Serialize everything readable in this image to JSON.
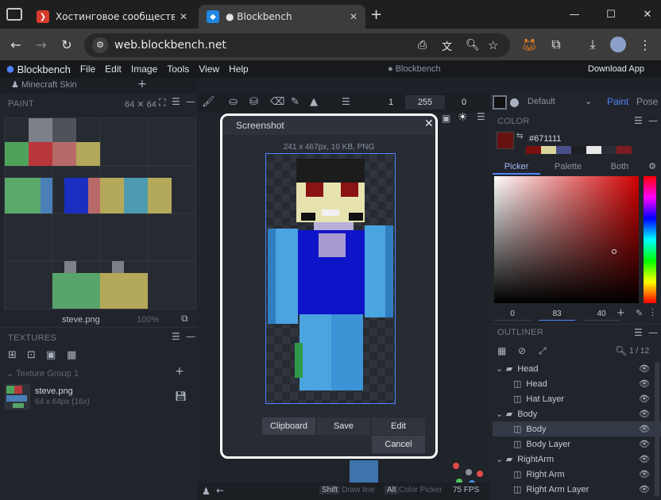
{
  "browser": {
    "tabs": [
      {
        "title": "Хостинговое сообщество «Tim",
        "active": false
      },
      {
        "title": "● Blockbench",
        "active": true
      }
    ],
    "url": "web.blockbench.net"
  },
  "app": {
    "name": "Blockbench",
    "menu": [
      "File",
      "Edit",
      "Image",
      "Tools",
      "View",
      "Help"
    ],
    "title": "● Blockbench",
    "download": "Download App",
    "project_tab": "Minecraft Skin"
  },
  "paint": {
    "header": "PAINT",
    "size": "64 ✕ 64",
    "filename": "steve.png",
    "zoom": "100%"
  },
  "textures": {
    "header": "TEXTURES",
    "group": "Texture Group 1",
    "item_name": "steve.png",
    "item_meta": "64 x 64px (16x)"
  },
  "tool_bar": {
    "v1": "1",
    "v2": "255",
    "v3": "0",
    "default": "Default"
  },
  "color": {
    "header": "COLOR",
    "hex": "#671111",
    "tabs": [
      "Picker",
      "Palette",
      "Both"
    ],
    "values": [
      "0",
      "83",
      "40"
    ],
    "mode_paint": "Paint",
    "mode_pose": "Pose",
    "swatches": [
      "#7a1010",
      "#d8d69a",
      "#4a4f8a",
      "#1d1f24",
      "#e8e8e8",
      "#2a2d33",
      "#7c1c22"
    ]
  },
  "outliner": {
    "header": "OUTLINER",
    "count": "1 / 12",
    "rows": [
      {
        "label": "Head",
        "type": "folder",
        "level": 0
      },
      {
        "label": "Head",
        "type": "cube",
        "level": 1
      },
      {
        "label": "Hat Layer",
        "type": "cube",
        "level": 1
      },
      {
        "label": "Body",
        "type": "folder",
        "level": 0
      },
      {
        "label": "Body",
        "type": "cube",
        "level": 1,
        "selected": true
      },
      {
        "label": "Body Layer",
        "type": "cube",
        "level": 1
      },
      {
        "label": "RightArm",
        "type": "folder",
        "level": 0
      },
      {
        "label": "Right Arm",
        "type": "cube",
        "level": 1
      },
      {
        "label": "Right Arm Layer",
        "type": "cube",
        "level": 1
      }
    ]
  },
  "status": {
    "shift_key": "Shift",
    "shift_label": "Draw line",
    "alt_key": "Alt",
    "alt_label": "Color Picker",
    "fps": "75 FPS"
  },
  "modal": {
    "title": "Screenshot",
    "info": "241 x 467px, 10 KB, PNG",
    "buttons": [
      "Clipboard",
      "Save",
      "Edit"
    ],
    "cancel": "Cancel"
  }
}
